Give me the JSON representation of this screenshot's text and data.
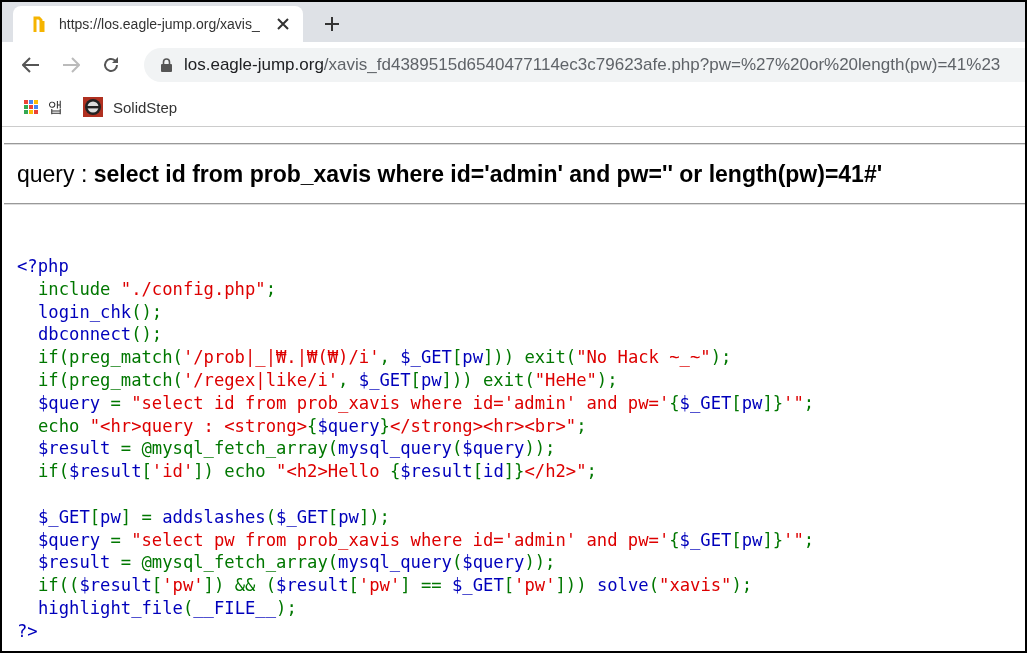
{
  "tabs": [
    {
      "title": "https://los.eagle-jump.org/xavis_",
      "selected": true
    }
  ],
  "nav_buttons": [
    {
      "kind": "back",
      "disabled": false
    },
    {
      "kind": "forward",
      "disabled": true
    },
    {
      "kind": "reload",
      "disabled": false
    }
  ],
  "address": {
    "host": "los.eagle-jump.org",
    "path": "/xavis_fd4389515d6540477114ec3c79623afe.php?pw=%27%20or%20length(pw)=41%23"
  },
  "bookmarks": [
    {
      "kind": "apps",
      "label": "앱"
    },
    {
      "kind": "site",
      "label": "SolidStep"
    }
  ],
  "query_line": "query : **select id from prob_xavis where id='admin' and pw='' or length(pw)=41#'**",
  "source": {
    "open": {
      "text": "<?php",
      "color": "#0000bb"
    },
    "close": {
      "text": "?>",
      "color": "#0000bb"
    },
    "blocks": [
      [
        [
          {
            "text": "include ",
            "color": "#007700"
          },
          {
            "text": "\"./config.php\"",
            "color": "#dd0000"
          },
          {
            "text": ";",
            "color": "#007700"
          }
        ],
        [
          {
            "text": "login_chk",
            "color": "#0000bb"
          },
          {
            "text": "();",
            "color": "#007700"
          }
        ],
        [
          {
            "text": "dbconnect",
            "color": "#0000bb"
          },
          {
            "text": "();",
            "color": "#007700"
          }
        ],
        [
          {
            "text": "if(preg_match(",
            "color": "#007700"
          },
          {
            "text": "'/prob|_|₩.|₩(₩)/i'",
            "color": "#dd0000"
          },
          {
            "text": ", ",
            "color": "#007700"
          },
          {
            "text": "$_GET",
            "color": "#0000bb"
          },
          {
            "text": "[",
            "color": "#007700"
          },
          {
            "text": "pw",
            "color": "#0000bb"
          },
          {
            "text": "])) exit(",
            "color": "#007700"
          },
          {
            "text": "\"No Hack ~_~\"",
            "color": "#dd0000"
          },
          {
            "text": ");",
            "color": "#007700"
          }
        ],
        [
          {
            "text": "if(preg_match(",
            "color": "#007700"
          },
          {
            "text": "'/regex|like/i'",
            "color": "#dd0000"
          },
          {
            "text": ", ",
            "color": "#007700"
          },
          {
            "text": "$_GET",
            "color": "#0000bb"
          },
          {
            "text": "[",
            "color": "#007700"
          },
          {
            "text": "pw",
            "color": "#0000bb"
          },
          {
            "text": "])) exit(",
            "color": "#007700"
          },
          {
            "text": "\"HeHe\"",
            "color": "#dd0000"
          },
          {
            "text": ");",
            "color": "#007700"
          }
        ],
        [
          {
            "text": "$query ",
            "color": "#0000bb"
          },
          {
            "text": "= ",
            "color": "#007700"
          },
          {
            "text": "\"select id from prob_xavis where id='admin' and pw='",
            "color": "#dd0000"
          },
          {
            "text": "{",
            "color": "#007700"
          },
          {
            "text": "$_GET",
            "color": "#0000bb"
          },
          {
            "text": "[",
            "color": "#007700"
          },
          {
            "text": "pw",
            "color": "#0000bb"
          },
          {
            "text": "]}",
            "color": "#007700"
          },
          {
            "text": "'\"",
            "color": "#dd0000"
          },
          {
            "text": ";",
            "color": "#007700"
          }
        ],
        [
          {
            "text": "echo ",
            "color": "#007700"
          },
          {
            "text": "\"<hr>query : <strong>",
            "color": "#dd0000"
          },
          {
            "text": "{",
            "color": "#007700"
          },
          {
            "text": "$query",
            "color": "#0000bb"
          },
          {
            "text": "}",
            "color": "#007700"
          },
          {
            "text": "</strong><hr><br>\"",
            "color": "#dd0000"
          },
          {
            "text": ";",
            "color": "#007700"
          }
        ],
        [
          {
            "text": "$result ",
            "color": "#0000bb"
          },
          {
            "text": "= @mysql_fetch_array(",
            "color": "#007700"
          },
          {
            "text": "mysql_query",
            "color": "#0000bb"
          },
          {
            "text": "(",
            "color": "#007700"
          },
          {
            "text": "$query",
            "color": "#0000bb"
          },
          {
            "text": "));",
            "color": "#007700"
          }
        ],
        [
          {
            "text": "if(",
            "color": "#007700"
          },
          {
            "text": "$result",
            "color": "#0000bb"
          },
          {
            "text": "[",
            "color": "#007700"
          },
          {
            "text": "'id'",
            "color": "#dd0000"
          },
          {
            "text": "]) echo ",
            "color": "#007700"
          },
          {
            "text": "\"<h2>Hello ",
            "color": "#dd0000"
          },
          {
            "text": "{",
            "color": "#007700"
          },
          {
            "text": "$result",
            "color": "#0000bb"
          },
          {
            "text": "[",
            "color": "#007700"
          },
          {
            "text": "id",
            "color": "#0000bb"
          },
          {
            "text": "]}",
            "color": "#007700"
          },
          {
            "text": "</h2>\"",
            "color": "#dd0000"
          },
          {
            "text": ";",
            "color": "#007700"
          }
        ]
      ],
      [
        [
          {
            "text": "$_GET",
            "color": "#0000bb"
          },
          {
            "text": "[",
            "color": "#007700"
          },
          {
            "text": "pw",
            "color": "#0000bb"
          },
          {
            "text": "] = ",
            "color": "#007700"
          },
          {
            "text": "addslashes",
            "color": "#0000bb"
          },
          {
            "text": "(",
            "color": "#007700"
          },
          {
            "text": "$_GET",
            "color": "#0000bb"
          },
          {
            "text": "[",
            "color": "#007700"
          },
          {
            "text": "pw",
            "color": "#0000bb"
          },
          {
            "text": "]);",
            "color": "#007700"
          }
        ],
        [
          {
            "text": "$query ",
            "color": "#0000bb"
          },
          {
            "text": "= ",
            "color": "#007700"
          },
          {
            "text": "\"select pw from prob_xavis where id='admin' and pw='",
            "color": "#dd0000"
          },
          {
            "text": "{",
            "color": "#007700"
          },
          {
            "text": "$_GET",
            "color": "#0000bb"
          },
          {
            "text": "[",
            "color": "#007700"
          },
          {
            "text": "pw",
            "color": "#0000bb"
          },
          {
            "text": "]}",
            "color": "#007700"
          },
          {
            "text": "'\"",
            "color": "#dd0000"
          },
          {
            "text": ";",
            "color": "#007700"
          }
        ],
        [
          {
            "text": "$result ",
            "color": "#0000bb"
          },
          {
            "text": "= @mysql_fetch_array(",
            "color": "#007700"
          },
          {
            "text": "mysql_query",
            "color": "#0000bb"
          },
          {
            "text": "(",
            "color": "#007700"
          },
          {
            "text": "$query",
            "color": "#0000bb"
          },
          {
            "text": "));",
            "color": "#007700"
          }
        ],
        [
          {
            "text": "if((",
            "color": "#007700"
          },
          {
            "text": "$result",
            "color": "#0000bb"
          },
          {
            "text": "[",
            "color": "#007700"
          },
          {
            "text": "'pw'",
            "color": "#dd0000"
          },
          {
            "text": "]) && (",
            "color": "#007700"
          },
          {
            "text": "$result",
            "color": "#0000bb"
          },
          {
            "text": "[",
            "color": "#007700"
          },
          {
            "text": "'pw'",
            "color": "#dd0000"
          },
          {
            "text": "] == ",
            "color": "#007700"
          },
          {
            "text": "$_GET",
            "color": "#0000bb"
          },
          {
            "text": "[",
            "color": "#007700"
          },
          {
            "text": "'pw'",
            "color": "#dd0000"
          },
          {
            "text": "])) ",
            "color": "#007700"
          },
          {
            "text": "solve",
            "color": "#0000bb"
          },
          {
            "text": "(",
            "color": "#007700"
          },
          {
            "text": "\"xavis\"",
            "color": "#dd0000"
          },
          {
            "text": ");",
            "color": "#007700"
          }
        ],
        [
          {
            "text": "highlight_file",
            "color": "#0000bb"
          },
          {
            "text": "(",
            "color": "#007700"
          },
          {
            "text": "__FILE__",
            "color": "#0000bb"
          },
          {
            "text": ");",
            "color": "#007700"
          }
        ]
      ]
    ]
  }
}
